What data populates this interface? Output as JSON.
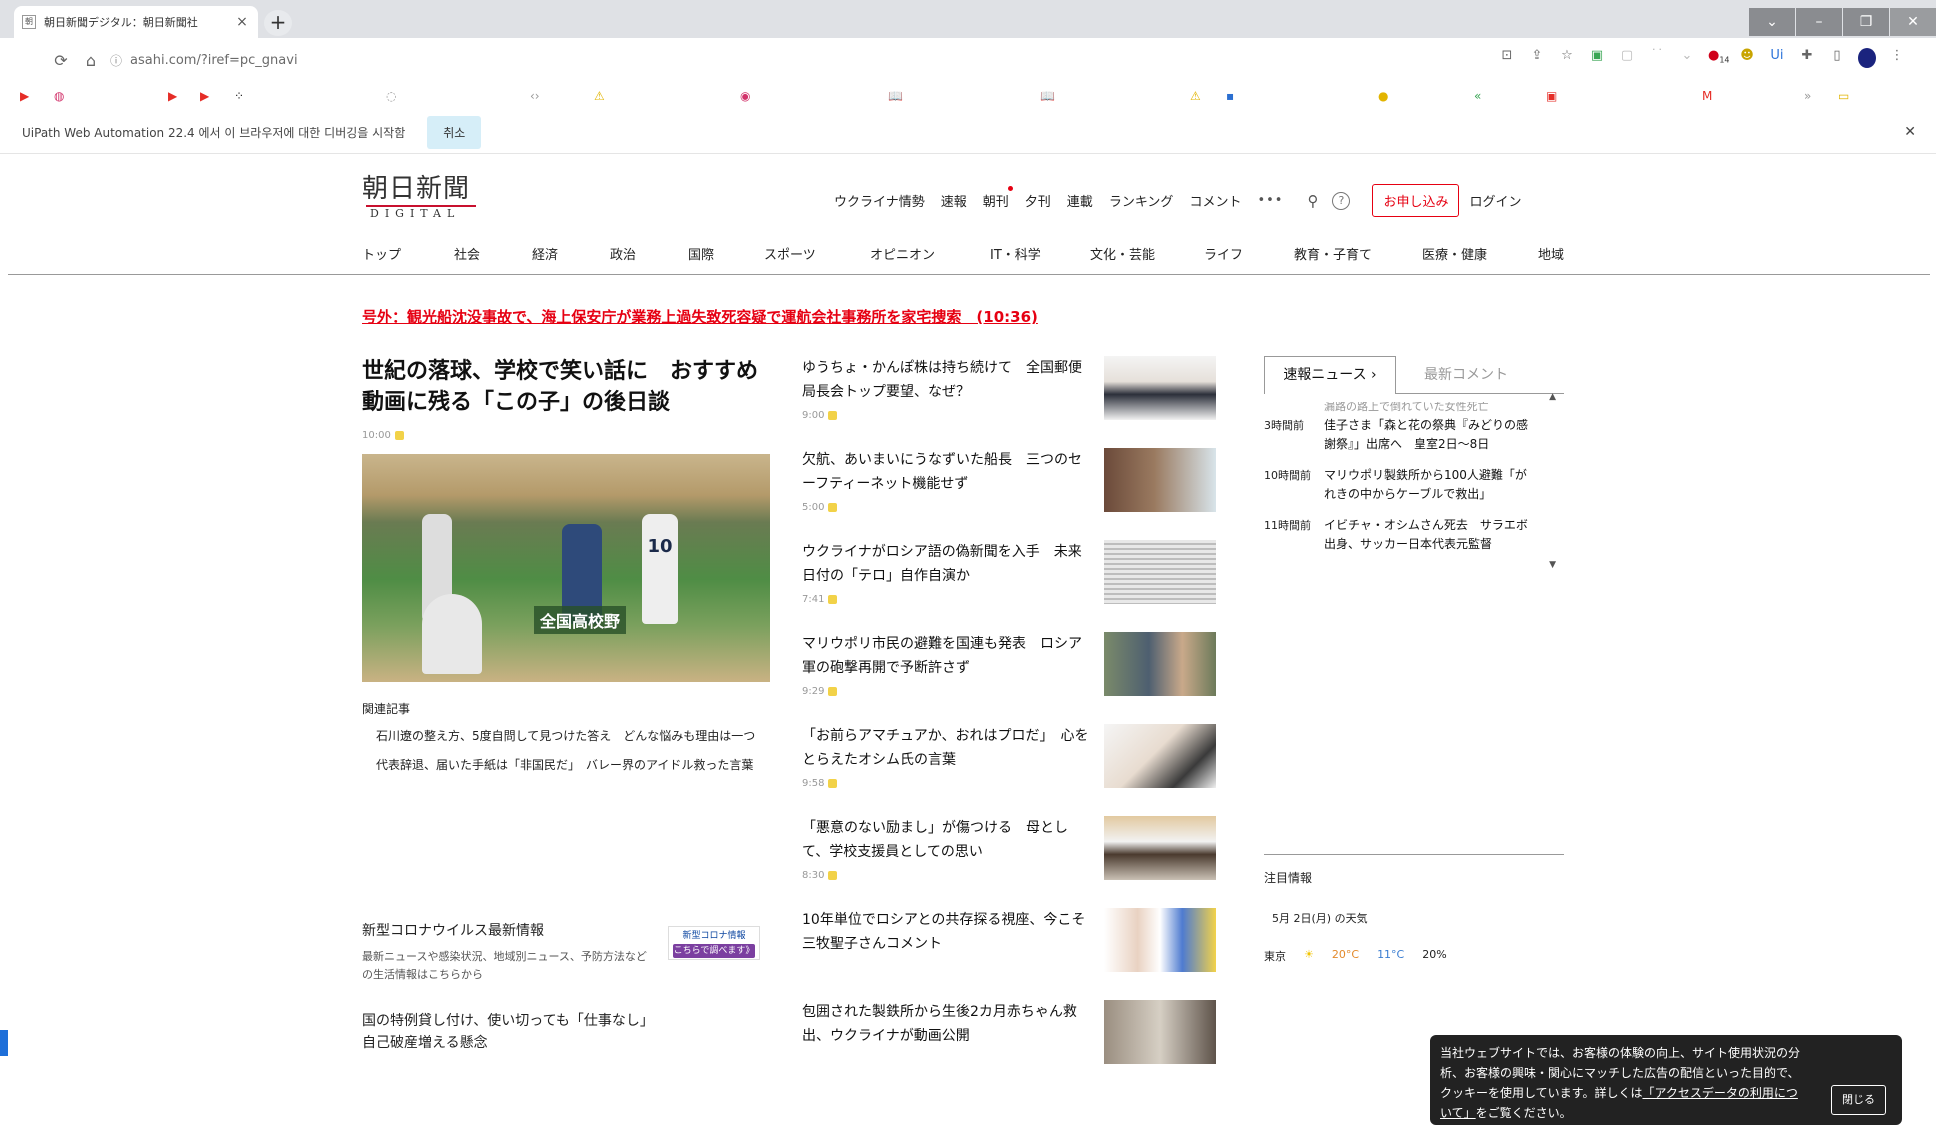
{
  "browser": {
    "tab_title": "朝日新聞デジタル：朝日新聞社",
    "tab_favicon": "朝",
    "url": "asahi.com/?iref=pc_gnavi",
    "ext_badge": "14"
  },
  "infobar": {
    "message": "UiPath Web Automation 22.4 에서 이 브라우저에 대한 디버깅을 시작함",
    "cancel_label": "취소"
  },
  "site": {
    "logo_jp": "朝日新聞",
    "logo_en": "DIGITAL",
    "topnav": [
      "ウクライナ情勢",
      "速報",
      "朝刊",
      "夕刊",
      "連載",
      "ランキング",
      "コメント"
    ],
    "more": "•••",
    "apply_label": "お申し込み",
    "login_label": "ログイン",
    "categories": [
      "トップ",
      "社会",
      "経済",
      "政治",
      "国際",
      "スポーツ",
      "オピニオン",
      "IT・科学",
      "文化・芸能",
      "ライフ",
      "教育・子育て",
      "医療・健康",
      "地域"
    ]
  },
  "breaking": "号外：観光船沈没事故で、海上保安庁が業務上過失致死容疑で運航会社事務所を家宅捜索　(10:36)",
  "lead": {
    "title": "世紀の落球、学校で笑い話に　おすすめ動画に残る「この子」の後日談",
    "time": "10:00",
    "photo_banner": "全国高校野",
    "photo_number": "10",
    "related_heading": "関連記事",
    "related": [
      "石川遼の整え方、5度自問して見つけた答え　どんな悩みも理由は一つ",
      "代表辞退、届いた手紙は「非国民だ」　バレー界のアイドル救った言葉"
    ]
  },
  "corona": {
    "title": "新型コロナウイルス最新情報",
    "desc": "最新ニュースや感染状況、地域別ニュース、予防方法などの生活情報はこちらから",
    "banner_line1": "新型コロナ情報",
    "banner_line2": "こちらで調べます》"
  },
  "loan_title": "国の特例貸し付け、使い切っても「仕事なし」　自己破産増える懸念",
  "articles": [
    {
      "title": "ゆうちょ・かんぽ株は持ち続けて　全国郵便局長会トップ要望、なぜ？",
      "time": "9:00"
    },
    {
      "title": "欠航、あいまいにうなずいた船長　三つのセーフティーネット機能せず",
      "time": "5:00"
    },
    {
      "title": "ウクライナがロシア語の偽新聞を入手　未来日付の「テロ」自作自演か",
      "time": "7:41"
    },
    {
      "title": "マリウポリ市民の避難を国連も発表　ロシア軍の砲撃再開で予断許さず",
      "time": "9:29"
    },
    {
      "title": "「お前らアマチュアか、おれはプロだ」　心をとらえたオシム氏の言葉",
      "time": "9:58"
    },
    {
      "title": "「悪意のない励まし」が傷つける　母として、学校支援員としての思い",
      "time": "8:30"
    },
    {
      "title": "10年単位でロシアとの共存探る視座、今こそ　三牧聖子さんコメント",
      "time": ""
    },
    {
      "title": "包囲された製鉄所から生後2カ月赤ちゃん救出、ウクライナが動画公開",
      "time": ""
    }
  ],
  "sidebar": {
    "tab_news": "速報ニュース ›",
    "tab_comments": "最新コメント",
    "clipped": "漏路の路上で倒れていた女性死亡",
    "news": [
      {
        "time": "3時間前",
        "text": "佳子さま「森と花の祭典『みどりの感謝祭』」出席へ　皇室2日～8日"
      },
      {
        "time": "10時間前",
        "text": "マリウポリ製鉄所から100人避難「がれきの中からケーブルで救出」"
      },
      {
        "time": "11時間前",
        "text": "イビチャ・オシムさん死去　サラエボ出身、サッカー日本代表元監督"
      }
    ]
  },
  "attention": {
    "heading": "注目情報",
    "weather_title": "5月 2日(月) の天気",
    "city": "東京",
    "high": "20°C",
    "low": "11°C",
    "rain": "20%"
  },
  "cookie": {
    "text_before": "当社ウェブサイトでは、お客様の体験の向上、サイト使用状況の分析、お客様の興味・関心にマッチした広告の配信といった目的で、クッキーを使用しています。詳しくは",
    "link": "「アクセスデータの利用について」",
    "text_after": "をご覧ください。",
    "close_label": "閉じる"
  },
  "colors": {
    "brand_red": "#e60012",
    "tab_bg": "#dfe1e5",
    "infobar_button": "#d6eef8"
  }
}
